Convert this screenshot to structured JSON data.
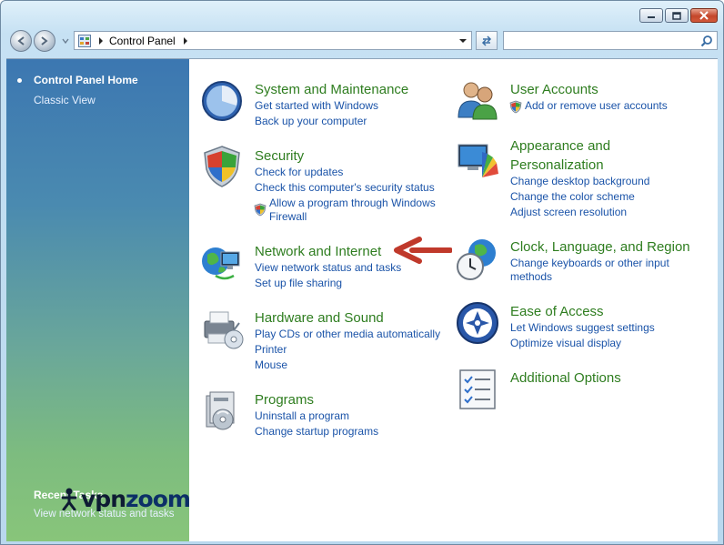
{
  "address": {
    "location": "Control Panel"
  },
  "search": {
    "placeholder": ""
  },
  "sidebar": {
    "home": "Control Panel Home",
    "classic": "Classic View",
    "recent_title": "Recent Tasks",
    "recent_item": "View network status and tasks"
  },
  "watermark": {
    "part1": "vpn",
    "part2": "zoom"
  },
  "categories": {
    "system": {
      "title": "System and Maintenance",
      "links": [
        "Get started with Windows",
        "Back up your computer"
      ]
    },
    "security": {
      "title": "Security",
      "links": [
        "Check for updates",
        "Check this computer's security status",
        "Allow a program through Windows",
        "Firewall"
      ]
    },
    "network": {
      "title": "Network and Internet",
      "links": [
        "View network status and tasks",
        "Set up file sharing"
      ]
    },
    "hardware": {
      "title": "Hardware and Sound",
      "links": [
        "Play CDs or other media automatically",
        "Printer",
        "Mouse"
      ]
    },
    "programs": {
      "title": "Programs",
      "links": [
        "Uninstall a program",
        "Change startup programs"
      ]
    },
    "users": {
      "title": "User Accounts",
      "links": [
        "Add or remove user accounts"
      ]
    },
    "appearance": {
      "title_line1": "Appearance and",
      "title_line2": "Personalization",
      "links": [
        "Change desktop background",
        "Change the color scheme",
        "Adjust screen resolution"
      ]
    },
    "clock": {
      "title": "Clock, Language, and Region",
      "links": [
        "Change keyboards or other input",
        "methods"
      ]
    },
    "access": {
      "title": "Ease of Access",
      "links": [
        "Let Windows suggest settings",
        "Optimize visual display"
      ]
    },
    "additional": {
      "title": "Additional Options"
    }
  },
  "colors": {
    "title_green": "#2e7d1f",
    "link_blue": "#1a53a8",
    "arrow_red": "#c0392b"
  }
}
